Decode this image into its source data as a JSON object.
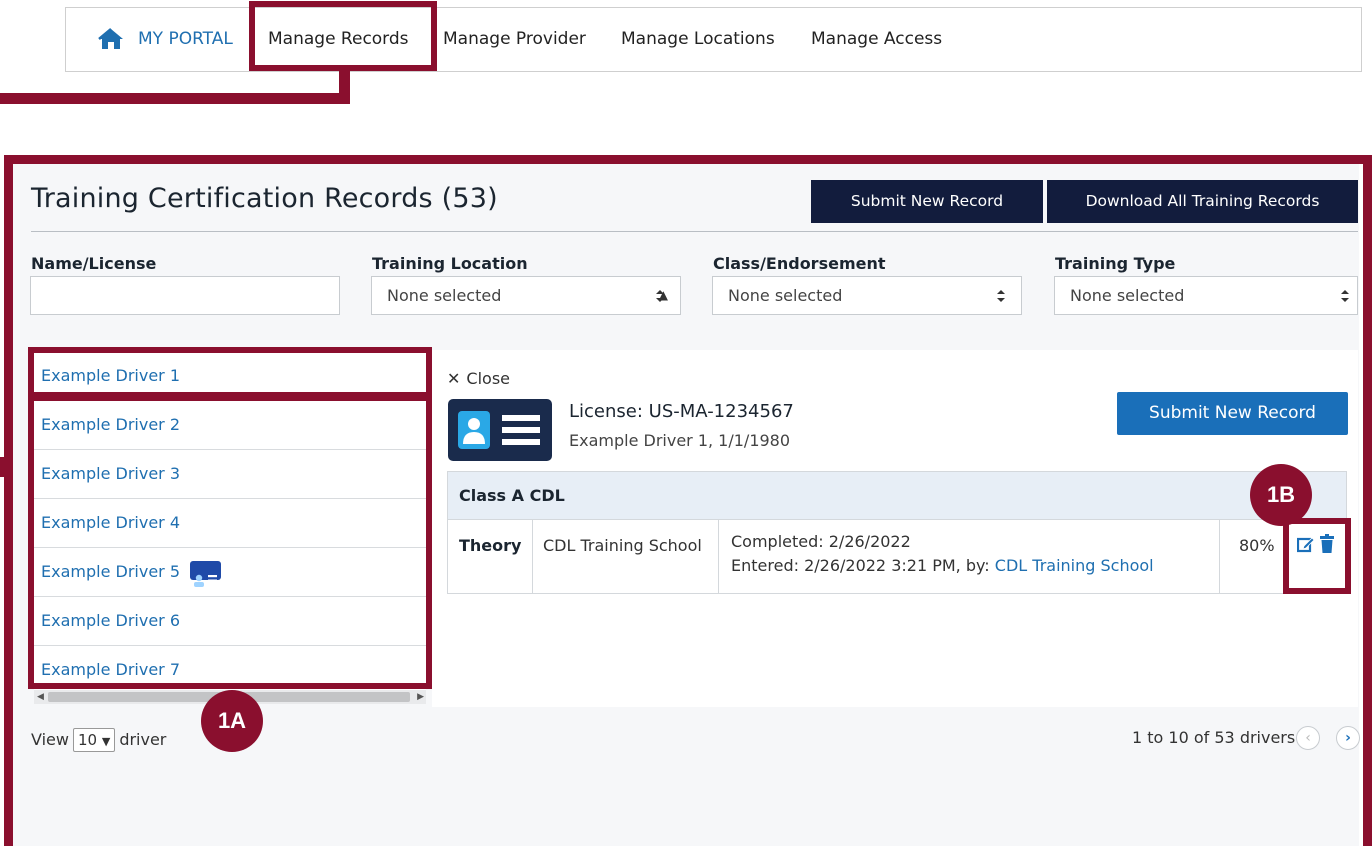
{
  "nav": {
    "home_label": "MY PORTAL",
    "items": [
      "Manage Records",
      "Manage Provider",
      "Manage Locations",
      "Manage Access"
    ]
  },
  "main": {
    "title": "Training Certification Records (53)",
    "submit_new_record": "Submit New Record",
    "download_all": "Download All Training Records"
  },
  "filters": {
    "name_license_label": "Name/License",
    "name_license_value": "",
    "training_location_label": "Training Location",
    "training_location_value": "None selected",
    "class_endorsement_label": "Class/Endorsement",
    "class_endorsement_value": "None selected",
    "training_type_label": "Training Type",
    "training_type_value": "None selected"
  },
  "drivers": [
    "Example Driver 1",
    "Example Driver 2",
    "Example Driver 3",
    "Example Driver 4",
    "Example Driver 5",
    "Example Driver 6",
    "Example Driver 7"
  ],
  "detail": {
    "close_label": "Close",
    "license_title": "License: US-MA-1234567",
    "license_sub": "Example Driver 1, 1/1/1980",
    "submit_new_record": "Submit New Record",
    "class_heading": "Class A CDL",
    "row": {
      "type": "Theory",
      "school": "CDL Training School",
      "completed": "Completed: 2/26/2022",
      "entered_prefix": "Entered: 2/26/2022 3:21 PM, by: ",
      "entered_by": "CDL Training School",
      "score": "80%"
    }
  },
  "footer": {
    "view_label": "View",
    "view_value": "10",
    "view_suffix": "driver",
    "paging": "1 to 10 of 53 drivers"
  },
  "markers": {
    "a": "1A",
    "b": "1B"
  },
  "colors": {
    "highlight": "#8a0f2e",
    "navy": "#121c3d",
    "link": "#1f6fb0",
    "primary": "#1a6fb9"
  }
}
